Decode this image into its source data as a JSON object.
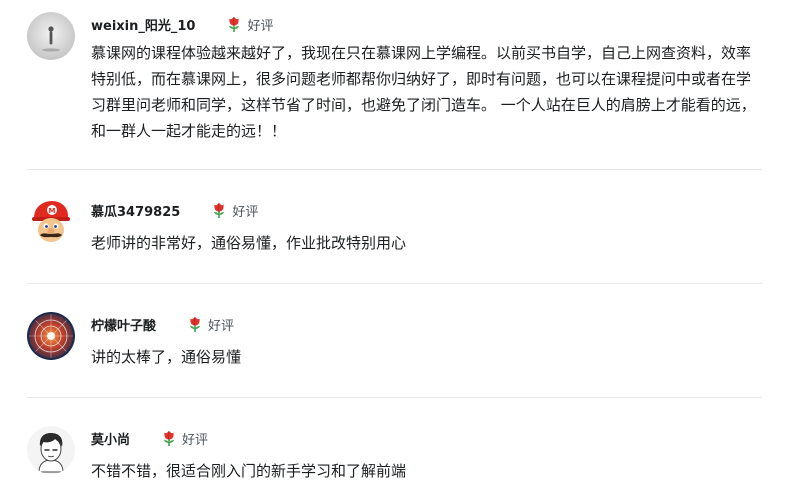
{
  "reviews": [
    {
      "username": "weixin_阳光_10",
      "rating_label": "好评",
      "avatar_icon": "avatar-standing-figure-icon",
      "content": "慕课网的课程体验越来越好了，我现在只在慕课网上学编程。以前买书自学，自己上网查资料，效率特别低，而在慕课网上，很多问题老师都帮你归纳好了，即时有问题，也可以在课程提问中或者在学习群里问老师和同学，这样节省了时间，也避免了闭门造车。 一个人站在巨人的肩膀上才能看的远，和一群人一起才能走的远！！"
    },
    {
      "username": "慕瓜3479825",
      "rating_label": "好评",
      "avatar_icon": "avatar-mario-icon",
      "content": "老师讲的非常好，通俗易懂，作业批改特别用心"
    },
    {
      "username": "柠檬叶子酸",
      "rating_label": "好评",
      "avatar_icon": "avatar-dartboard-icon",
      "content": "讲的太棒了，通俗易懂"
    },
    {
      "username": "莫小尚",
      "rating_label": "好评",
      "avatar_icon": "avatar-cartoon-boy-icon",
      "content": "不错不错，很适合刚入门的新手学习和了解前端"
    }
  ],
  "colors": {
    "rose_red": "#e0322b",
    "leaf_green": "#3aa346",
    "divider": "#e8e8e8",
    "text": "#1c1f21",
    "muted": "#4d555d"
  }
}
